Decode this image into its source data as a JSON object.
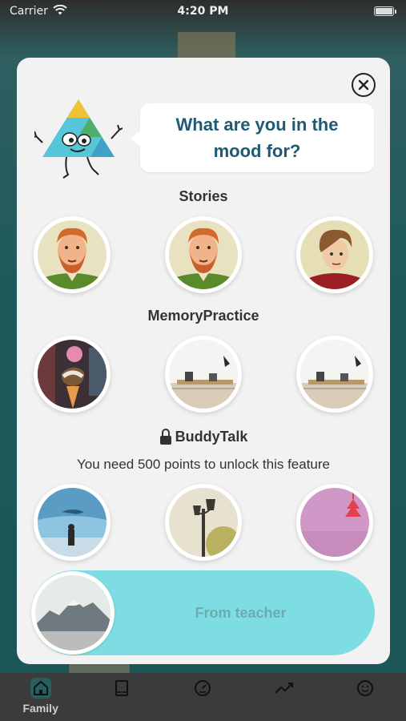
{
  "status_bar": {
    "carrier": "Carrier",
    "time": "4:20 PM"
  },
  "modal": {
    "prompt": "What are you in the mood for?",
    "sections": {
      "stories": {
        "title": "Stories",
        "items": [
          "ginger-beard-man-avatar",
          "ginger-beard-man-avatar",
          "brown-hair-boy-avatar"
        ]
      },
      "memory": {
        "title": "MemoryPractice",
        "items": [
          "ice-cream-photo",
          "office-room-photo",
          "office-room-photo"
        ]
      },
      "buddy": {
        "title": "BuddyTalk",
        "locked": true,
        "lock_note": "You need 500 points to unlock this feature",
        "items": [
          "aquarium-photo",
          "street-lamp-photo",
          "pink-sky-photo"
        ]
      }
    },
    "teacher_button": {
      "label": "From teacher",
      "image": "mountain-photo"
    }
  },
  "tabbar": {
    "items": [
      {
        "label": "Family",
        "icon": "home-icon",
        "active": true
      },
      {
        "label": "",
        "icon": "book-icon",
        "active": false
      },
      {
        "label": "",
        "icon": "gauge-icon",
        "active": false
      },
      {
        "label": "",
        "icon": "trend-icon",
        "active": false
      },
      {
        "label": "",
        "icon": "smiley-icon",
        "active": false
      }
    ]
  },
  "colors": {
    "accent": "#7ddde3",
    "prompt_text": "#1d5a73",
    "modal_bg": "#f2f2f2",
    "teacher_label": "#6cacb0"
  }
}
